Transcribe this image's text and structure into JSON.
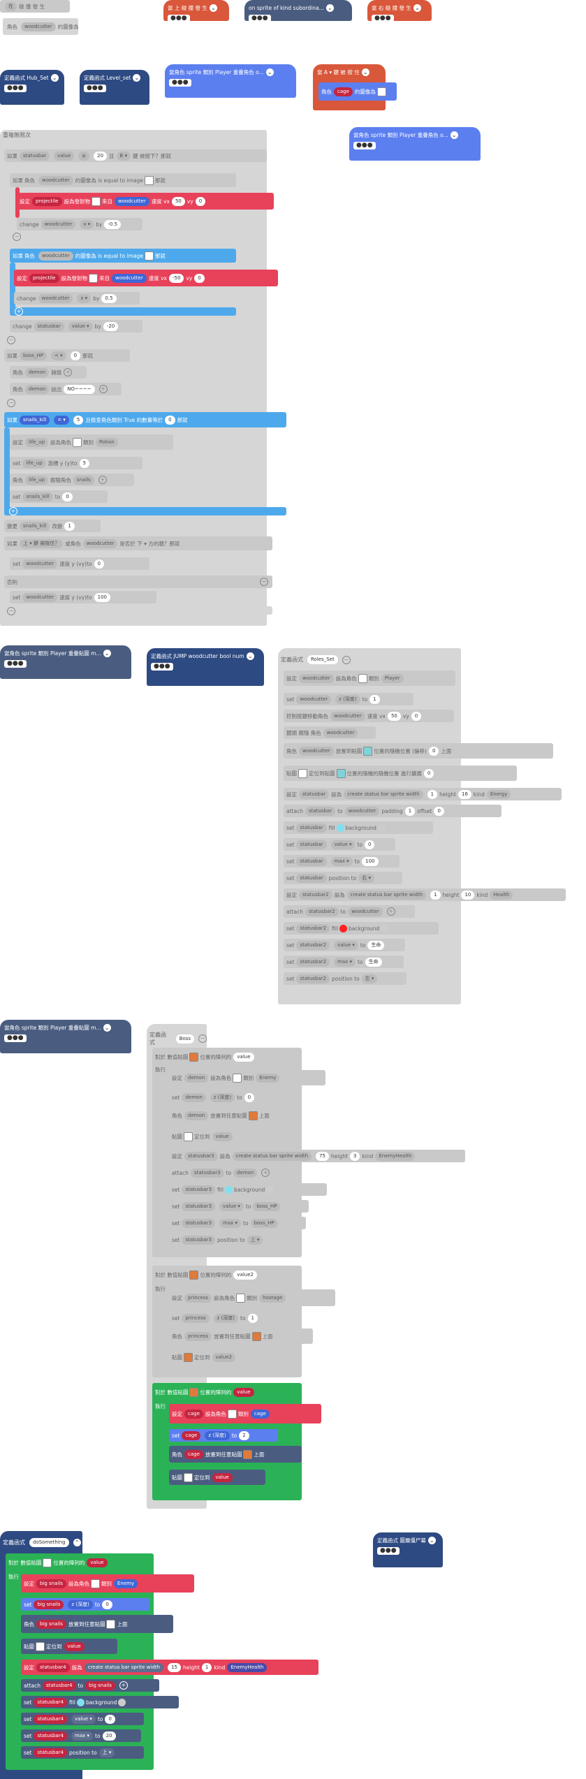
{
  "top": {
    "grey_stub": {
      "l1": "在",
      "l2": "碰 撞 發 生",
      "sprite": "woodcutter",
      "text": "的圖像為"
    },
    "hat_on_hit_1": {
      "label": "當 上 碰 撞 發 生"
    },
    "hat_on_sprite_kind": {
      "label": "on sprite of kind subordina..."
    },
    "hat_on_hit_2": {
      "label": "當 右 碰 撞 發 生"
    },
    "hat_hub_set": {
      "label": "定義函式 Hub_Set"
    },
    "hat_level_set": {
      "label": "定義函式 Level_set"
    },
    "hat_overlap_1": {
      "label": "當角色 sprite 類別 Player 重疊角色 o..."
    },
    "hat_a_press": {
      "label": "當 A ▾ 鍵 被 按 住",
      "text": "角色",
      "sprite": "cage",
      "text2": "的圖像為"
    },
    "hat_overlap_2": {
      "label": "當角色 sprite 類別 Player 重疊角色 o..."
    },
    "dots": "●●●"
  },
  "loop": {
    "title": "重複無限次",
    "if1": {
      "kw": "如果",
      "var": "statusbar",
      "field": "value",
      "op": "≥",
      "num": "20",
      "and": "且",
      "key": "B ▾",
      "tail": "鍵 被按下？",
      "then": "那就"
    },
    "if2": {
      "kw": "如果",
      "text": "角色",
      "sprite": "woodcutter",
      "tail": "的圖像為 is equal to image",
      "then": "那就"
    },
    "proj1": {
      "kw": "設定",
      "var": "projectile",
      "to": "設為",
      "fire": "發射物",
      "from": "來自",
      "sprite": "woodcutter",
      "vx_label": "速度 vx",
      "vx": "50",
      "vy_label": "vy",
      "vy": "0"
    },
    "change1": {
      "kw": "change",
      "sprite": "woodcutter",
      "axis": "x ▾",
      "by": "by",
      "num": "-0.5"
    },
    "if3": {
      "kw": "如果",
      "text": "角色",
      "sprite": "woodcutter",
      "tail": "的圖像為 is equal to image",
      "then": "那就"
    },
    "proj2": {
      "kw": "設定",
      "var": "projectile",
      "to": "設為",
      "fire": "發射物",
      "from": "來自",
      "sprite": "woodcutter",
      "vx_label": "速度 vx",
      "vx": "-50",
      "vy_label": "vy",
      "vy": "0"
    },
    "change2": {
      "kw": "change",
      "sprite": "woodcutter",
      "axis": "x ▾",
      "by": "by",
      "num": "0.5"
    },
    "change3": {
      "kw": "change",
      "var": "statusbar",
      "field": "value ▾",
      "by": "by",
      "num": "-20"
    },
    "if_boss": {
      "kw": "如果",
      "var": "boss_HP",
      "op": "< ▾",
      "num": "0",
      "then": "那就"
    },
    "destroy_demon": {
      "kw": "角色",
      "sprite": "demon",
      "act": "銷毀"
    },
    "say_demon": {
      "kw": "角色",
      "sprite": "demon",
      "act": "說出",
      "text": "NO~~~~"
    },
    "if_snails": {
      "kw": "如果",
      "var": "snails_kill",
      "op": "= ▾",
      "num": "5",
      "and": "且",
      "tail": "檢查角色類別 True 的數量等於",
      "num2": "0",
      "then": "那就"
    },
    "set_life": {
      "kw": "設定",
      "var": "life_up",
      "to": "設為",
      "sprite_label": "角色",
      "kind_label": "類別",
      "kind": "Potion"
    },
    "set_life_y": {
      "kw": "set",
      "var": "life_up",
      "prop": "游標 y (y)",
      "to": "to",
      "num": "5"
    },
    "follow_life": {
      "kw": "角色",
      "var": "life_up",
      "act": "跟隨角色",
      "target": "snails"
    },
    "set_snails": {
      "kw": "set",
      "var": "snails_kill",
      "to": "to",
      "num": "0"
    },
    "change_snails": {
      "kw": "變更",
      "var": "snails_kill",
      "by": "改變",
      "num": "1"
    },
    "if_up": {
      "kw": "如果",
      "text": "上 ▾ 鍵 被按住？",
      "or": "或",
      "text2": "角色",
      "sprite": "woodcutter",
      "tail": "是否於 下 ▾ 方的牆？",
      "then": "那就"
    },
    "set_wood_y1": {
      "kw": "set",
      "sprite": "woodcutter",
      "prop": "速度 y (vy)",
      "to": "to",
      "num": "0"
    },
    "else": {
      "kw": "否則"
    },
    "set_wood_y2": {
      "kw": "set",
      "sprite": "woodcutter",
      "prop": "速度 y (vy)",
      "to": "to",
      "num": "100"
    }
  },
  "mid": {
    "hat_overlap_3": {
      "label": "當角色 sprite 類別 Player 重疊貼圖 m..."
    },
    "hat_jump": {
      "label": "定義函式 JUMP woodcutter bool num"
    },
    "roles": {
      "title": "定義函式",
      "name": "Roles_Set",
      "r1": {
        "kw": "設定",
        "var": "woodcutter",
        "to": "設為",
        "sprite_label": "角色",
        "kind_label": "類別",
        "kind": "Player"
      },
      "r2": {
        "kw": "set",
        "var": "woodcutter",
        "prop": "z (深度)",
        "to": "to",
        "num": "1"
      },
      "r3": {
        "kw": "控制按鍵移動角色",
        "var": "woodcutter",
        "vx": "速度 vx",
        "num": "50",
        "vy": "vy",
        "num2": "0"
      },
      "r4": {
        "kw": "鏡頭 跟隨 角色",
        "var": "woodcutter"
      },
      "r5": {
        "kw": "角色",
        "var": "woodcutter",
        "act": "放置到",
        "img": "貼圖",
        "tail": "位置的隨機",
        "tail2": "位置 (偏移)",
        "num": "0",
        "top": "上面"
      },
      "r6": {
        "kw": "貼圖",
        "act": "定位到",
        "img": "貼圖",
        "tail": "位置的隨機",
        "tail2": "的隨機位置 進行擴展",
        "num": "0"
      },
      "r7": {
        "kw": "設定",
        "var": "statusbar",
        "to": "設為",
        "txt": "create status bar sprite width",
        "w": "1",
        "h_label": "height",
        "h": "16",
        "kind_label": "kind",
        "kind": "Energy"
      },
      "r8": {
        "kw": "attach",
        "var": "statusbar",
        "to": "to",
        "target": "woodcutter",
        "pad": "padding",
        "p": "1",
        "off": "offset",
        "o": "0"
      },
      "r9": {
        "kw": "set",
        "var": "statusbar",
        "fill": "fill",
        "bg": "background"
      },
      "r10": {
        "kw": "set",
        "var": "statusbar",
        "field": "value ▾",
        "to": "to",
        "num": "0"
      },
      "r11": {
        "kw": "set",
        "var": "statusbar",
        "field": "max ▾",
        "to": "to",
        "num": "100"
      },
      "r12": {
        "kw": "set",
        "var": "statusbar",
        "field": "position to",
        "val": "右 ▾"
      },
      "r13": {
        "kw": "設定",
        "var": "statusbar2",
        "to": "設為",
        "txt": "create status bar sprite width",
        "w": "1",
        "h_label": "height",
        "h": "10",
        "kind_label": "kind",
        "kind": "Health"
      },
      "r14": {
        "kw": "attach",
        "var": "statusbar2",
        "to": "to",
        "target": "woodcutter"
      },
      "r15": {
        "kw": "set",
        "var": "statusbar2",
        "fill": "fill",
        "bg": "background"
      },
      "r16": {
        "kw": "set",
        "var": "statusbar2",
        "field": "value ▾",
        "to": "to",
        "num": "生命"
      },
      "r17": {
        "kw": "set",
        "var": "statusbar2",
        "field": "max ▾",
        "to": "to",
        "num": "生命"
      },
      "r18": {
        "kw": "set",
        "var": "statusbar2",
        "field": "position to",
        "val": "左 ▾"
      }
    }
  },
  "boss": {
    "hat_overlap_4": {
      "label": "當角色 sprite 類別 Player 重疊貼圖 m..."
    },
    "title": "定義函式",
    "name": "Boss",
    "for1": {
      "kw": "對於 數值",
      "img": "貼圖",
      "tail": "位置的陣列",
      "in": "的",
      "var": "value",
      "exec": "執行"
    },
    "b1": {
      "kw": "設定",
      "var": "demon",
      "to": "設為",
      "sprite_label": "角色",
      "kind_label": "類別",
      "kind": "Enemy"
    },
    "b2": {
      "kw": "set",
      "var": "demon",
      "prop": "z (深度)",
      "to": "to",
      "num": "0"
    },
    "b3": {
      "kw": "角色",
      "var": "demon",
      "act": "放置到任意貼圖",
      "top": "上面"
    },
    "b4": {
      "kw": "貼圖",
      "act": "定位到",
      "var": "value"
    },
    "b5": {
      "kw": "設定",
      "var": "statusbar3",
      "to": "設為",
      "txt": "create status bar sprite width",
      "w": "75",
      "h_label": "height",
      "h": "3",
      "kind_label": "kind",
      "kind": "EnemyHealth"
    },
    "b6": {
      "kw": "attach",
      "var": "statusbar3",
      "to": "to",
      "target": "demon"
    },
    "b7": {
      "kw": "set",
      "var": "statusbar3",
      "fill": "fill",
      "bg": "background"
    },
    "b8": {
      "kw": "set",
      "var": "statusbar3",
      "field": "value ▾",
      "to": "to",
      "val": "boss_HP"
    },
    "b9": {
      "kw": "set",
      "var": "statusbar3",
      "field": "max ▾",
      "to": "to",
      "val": "boss_HP"
    },
    "b10": {
      "kw": "set",
      "var": "statusbar3",
      "field": "position to",
      "val": "上 ▾"
    },
    "for2": {
      "kw": "對於 數值",
      "img": "貼圖",
      "tail": "位置的陣列",
      "in": "的",
      "var": "value2",
      "exec": "執行"
    },
    "c1": {
      "kw": "設定",
      "var": "princess",
      "to": "設為",
      "sprite_label": "角色",
      "kind_label": "類別",
      "kind": "hostage"
    },
    "c2": {
      "kw": "set",
      "var": "princess",
      "prop": "z (深度)",
      "to": "to",
      "num": "1"
    },
    "c3": {
      "kw": "角色",
      "var": "princess",
      "act": "放置到任意貼圖",
      "top": "上面"
    },
    "c4": {
      "kw": "貼圖",
      "act": "定位到",
      "var": "value2"
    },
    "for3": {
      "kw": "對於 數值",
      "img": "貼圖",
      "tail": "位置的陣列",
      "in": "的",
      "var": "value",
      "exec": "執行"
    },
    "d1": {
      "kw": "設定",
      "var": "cage",
      "to": "設為",
      "sprite_label": "角色",
      "kind_label": "類別",
      "kind": "cage"
    },
    "d2": {
      "kw": "set",
      "var": "cage",
      "prop": "z (深度)",
      "to": "to",
      "num": "2"
    },
    "d3": {
      "kw": "角色",
      "var": "cage",
      "act": "放置到任意貼圖",
      "top": "上面"
    },
    "d4": {
      "kw": "貼圖",
      "act": "定位到",
      "var": "value"
    }
  },
  "bottom": {
    "title": "定義函式",
    "name": "doSomething",
    "hat_right": {
      "label": "定義函式 圖層僵尸幕"
    },
    "for": {
      "kw": "對於 數值",
      "img": "貼圖",
      "tail": "位置的陣列",
      "in": "的",
      "var": "value",
      "exec": "執行"
    },
    "e1": {
      "kw": "設定",
      "var": "big snails",
      "to": "設為",
      "sprite_label": "角色",
      "kind_label": "類別",
      "kind": "Enemy"
    },
    "e2": {
      "kw": "set",
      "var": "big snails",
      "prop": "z (深度)",
      "to": "to",
      "num": "0"
    },
    "e3": {
      "kw": "角色",
      "var": "big snails",
      "act": "放置到任意貼圖",
      "top": "上面"
    },
    "e4": {
      "kw": "貼圖",
      "act": "定位到",
      "var": "value"
    },
    "e5": {
      "kw": "設定",
      "var": "statusbar4",
      "to": "設為",
      "txt": "create status bar sprite width",
      "w": "15",
      "h_label": "height",
      "h": "1",
      "kind_label": "kind",
      "kind": "EnemyHealth"
    },
    "e6": {
      "kw": "attach",
      "var": "statusbar4",
      "to": "to",
      "target": "big snails"
    },
    "e7": {
      "kw": "set",
      "var": "statusbar4",
      "fill": "fill",
      "bg": "background"
    },
    "e8": {
      "kw": "set",
      "var": "statusbar4",
      "field": "value ▾",
      "to": "to",
      "num": "0"
    },
    "e9": {
      "kw": "set",
      "var": "statusbar4",
      "field": "max ▾",
      "to": "to",
      "num": "20"
    },
    "e10": {
      "kw": "set",
      "var": "statusbar4",
      "field": "position to",
      "val": "上 ▾"
    }
  },
  "colors": {
    "red": "#e8415a",
    "blue": "#5c7ff0",
    "navy": "#2e4a82",
    "green": "#2bb256",
    "grey": "#c9c9c9",
    "orange": "#d9573a",
    "lightblue": "#4ea9ec"
  }
}
